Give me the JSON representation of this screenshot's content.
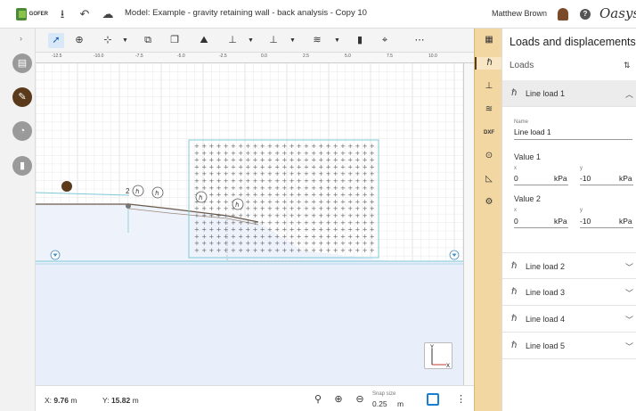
{
  "header": {
    "logo_text": "GOFER",
    "title": "Model: Example - gravity retaining wall - back analysis - Copy 10",
    "user": "Matthew Brown",
    "help_label": "?",
    "brand": "Oasys"
  },
  "ruler": {
    "top_labels": [
      "-12.5",
      "-10.0",
      "-7.5",
      "-5.0",
      "-2.5",
      "0.0",
      "2.5",
      "5.0",
      "7.5",
      "10.0"
    ]
  },
  "canvas": {
    "labels": [
      "2"
    ]
  },
  "status": {
    "x_label": "X:",
    "x_value": "9.76",
    "x_unit": "m",
    "y_label": "Y:",
    "y_value": "15.82",
    "y_unit": "m",
    "snap_label": "Snap size",
    "snap_value": "0.25",
    "snap_unit": "m"
  },
  "vstrip": {
    "dxf_label": "DXF"
  },
  "panel": {
    "title": "Loads and displacements",
    "section": "Loads",
    "loads": [
      {
        "label": "Line load 1",
        "name_label": "Name",
        "name_value": "Line load 1",
        "value1_label": "Value 1",
        "value1_x": "0",
        "value1_y": "-10",
        "value2_label": "Value 2",
        "value2_x": "0",
        "value2_y": "-10",
        "x_label": "x",
        "y_label": "y",
        "unit": "kPa"
      },
      {
        "label": "Line load 2"
      },
      {
        "label": "Line load 3"
      },
      {
        "label": "Line load 4"
      },
      {
        "label": "Line load 5"
      }
    ]
  },
  "colors": {
    "accent": "#1a7fd4",
    "strip": "#f3d7a2",
    "active_rail": "#5a3a1a",
    "soil_fill": "#e8eefa"
  }
}
